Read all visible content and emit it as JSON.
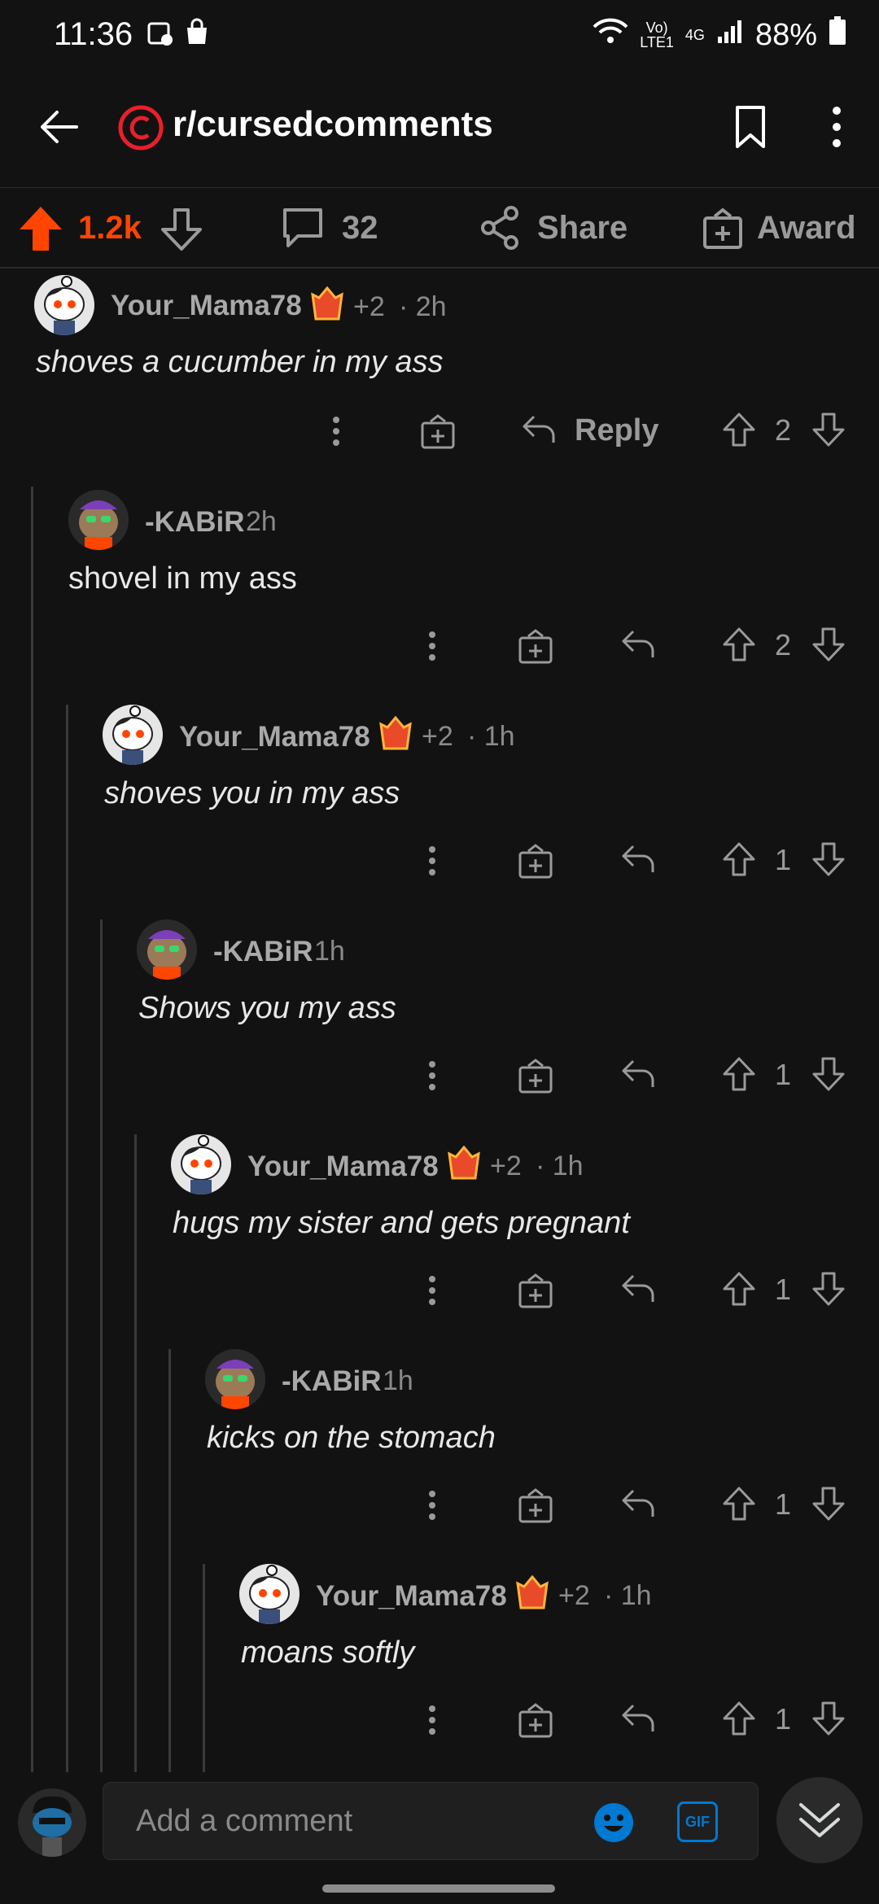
{
  "status_bar": {
    "time": "11:36",
    "network": "4G",
    "carrier": "LTE1",
    "battery": "88%"
  },
  "header": {
    "subreddit": "r/cursedcomments"
  },
  "post_bar": {
    "upvotes": "1.2k",
    "comments": "32",
    "share_label": "Share",
    "award_label": "Award",
    "accent": "#ff4500"
  },
  "comments": [
    {
      "author": "Your_Mama78",
      "flair": "+2",
      "time": "· 2h",
      "body": "shoves a cucumber in my ass",
      "votes": "2",
      "reply_label": "Reply"
    },
    {
      "author": "-KABiR",
      "time": "2h",
      "body": "shovel in my ass",
      "votes": "2"
    },
    {
      "author": "Your_Mama78",
      "flair": "+2",
      "time": "· 1h",
      "body": "shoves you in my ass",
      "votes": "1"
    },
    {
      "author": "-KABiR",
      "time": "1h",
      "body": "Shows you my ass",
      "votes": "1"
    },
    {
      "author": "Your_Mama78",
      "flair": "+2",
      "time": "· 1h",
      "body": "hugs my sister and gets pregnant",
      "votes": "1"
    },
    {
      "author": "-KABiR",
      "time": "1h",
      "body": "kicks on the stomach",
      "votes": "1"
    },
    {
      "author": "Your_Mama78",
      "flair": "+2",
      "time": "· 1h",
      "body": "moans softly",
      "votes": "1"
    }
  ],
  "composer": {
    "placeholder": "Add a comment",
    "gif_label": "GIF"
  }
}
